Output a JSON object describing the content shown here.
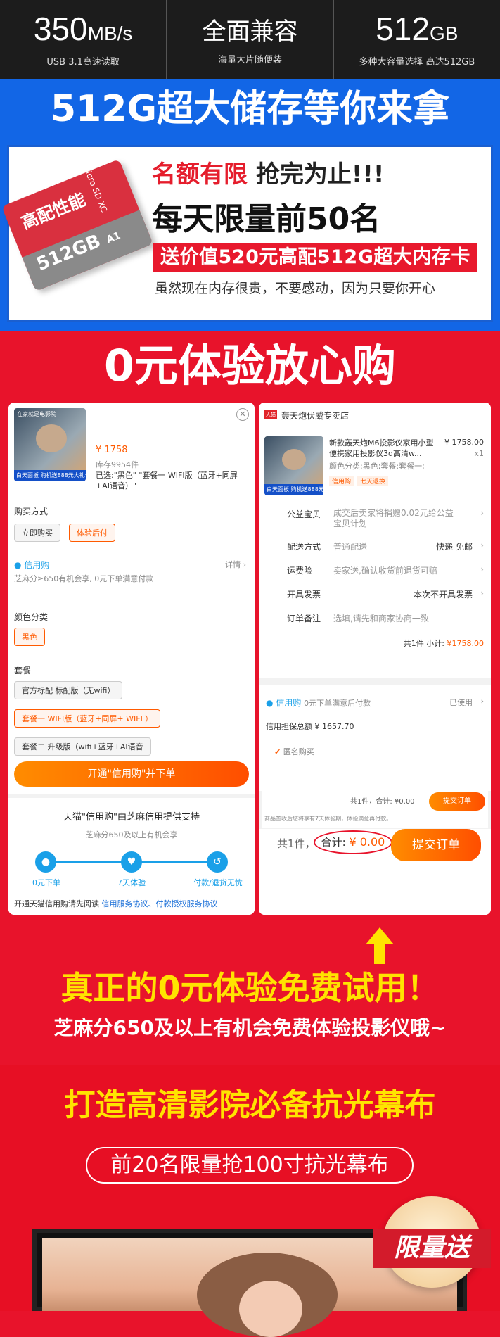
{
  "specs": [
    {
      "big": "350",
      "unit": "MB/s",
      "sub": "USB 3.1高速读取"
    },
    {
      "big": "全面兼容",
      "unit": "",
      "sub": "海量大片随便装"
    },
    {
      "big": "512",
      "unit": "GB",
      "sub": "多种大容量选择 高达512GB"
    }
  ],
  "storage": {
    "title": "512G超大储存等你来拿",
    "card_label": "高配性能",
    "card_size": "512GB",
    "card_micro": "micro SD XC",
    "card_a1": "A1",
    "limit_red": "名额有限",
    "limit_rest": " 抢完为止!!!",
    "daily": "每天限量前50名",
    "gift": "送价值520元高配512G超大内存卡",
    "note": "虽然现在内存很贵，不要感动，因为只要你开心"
  },
  "experience": {
    "title": "0元体验放心购",
    "left": {
      "thumb_top": "在家就是电影院",
      "thumb_strip": "白天面板 购机送888元大礼包",
      "price": "¥ 1758",
      "stock": "库存9954件",
      "selected": "已选:\"黑色\" \"套餐一 WIFI版（蓝牙+同屏+AI语音）\"",
      "buy_method": "购买方式",
      "buy_now": "立即购买",
      "pay_later": "体验后付",
      "credit": "信用购",
      "details": "详情",
      "credit_note": "芝麻分≥650有机会享, 0元下单满意付款",
      "color_cat": "颜色分类",
      "color_black": "黑色",
      "package": "套餐",
      "pkg_official": "官方标配 标配版（无wifi）",
      "pkg_one": "套餐一 WIFI版（蓝牙+同屏+ WIFI ）",
      "pkg_two": "套餐二 升级版（wifi+蓝牙+AI语音",
      "open_btn": "开通\"信用购\"并下单",
      "support": "天猫\"信用购\"由芝麻信用提供支持",
      "support_sub": "芝麻分650及以上有机会享",
      "step1": "0元下单",
      "step2": "7天体验",
      "step3": "付款/退货无忧",
      "agree": "开通天猫信用购请先阅读",
      "agree_link": "信用服务协议、付款授权服务协议"
    },
    "right": {
      "tmall": "天猫",
      "shop": "轰天炮伏威专卖店",
      "product": "新款轰天炮M6投影仪家用小型便携家用投影仪3d高清w...",
      "price": "¥ 1758.00",
      "qty": "x1",
      "spec": "颜色分类:黑色;套餐:套餐一;",
      "tag1": "信用购",
      "tag2": "七天退换",
      "rows": [
        {
          "k": "公益宝贝",
          "v": "成交后卖家将捐赠0.02元给公益宝贝计划",
          "r": ""
        },
        {
          "k": "配送方式",
          "v": "普通配送",
          "r": "快递 免邮"
        },
        {
          "k": "运费险",
          "v": "卖家送,确认收货前退货可赔",
          "r": ""
        },
        {
          "k": "开具发票",
          "v": "",
          "r": "本次不开具发票"
        },
        {
          "k": "订单备注",
          "v": "选填,请先和商家协商一致",
          "r": ""
        }
      ],
      "subtotal_label": "共1件 小计:",
      "subtotal": "¥1758.00",
      "credit": "信用购",
      "credit_note": "0元下单满意后付款",
      "used": "已使用",
      "guarantee": "信用担保总额 ¥ 1657.70",
      "anon": "匿名购买",
      "mini_total": "共1件，合计: ¥0.00",
      "mini_submit": "提交订单",
      "mini_note": "商品签收后您将享有7天体验期，体验满意再付款。",
      "total_prefix": "共1件，",
      "total_label": "合计: ",
      "total": "¥ 0.00",
      "submit": "提交订单"
    },
    "headline": "真正的0元体验免费试用！",
    "sesame": "芝麻分650及以上有机会免费体验投影仪哦~"
  },
  "screen": {
    "title": "打造高清影院必备抗光幕布",
    "pill": "前20名限量抢100寸抗光幕布",
    "badge": "限量送"
  },
  "colors": {
    "accent": "#e8132b",
    "blue": "#1266e6",
    "yellow": "#ffe300",
    "orange": "#ff5a00"
  }
}
